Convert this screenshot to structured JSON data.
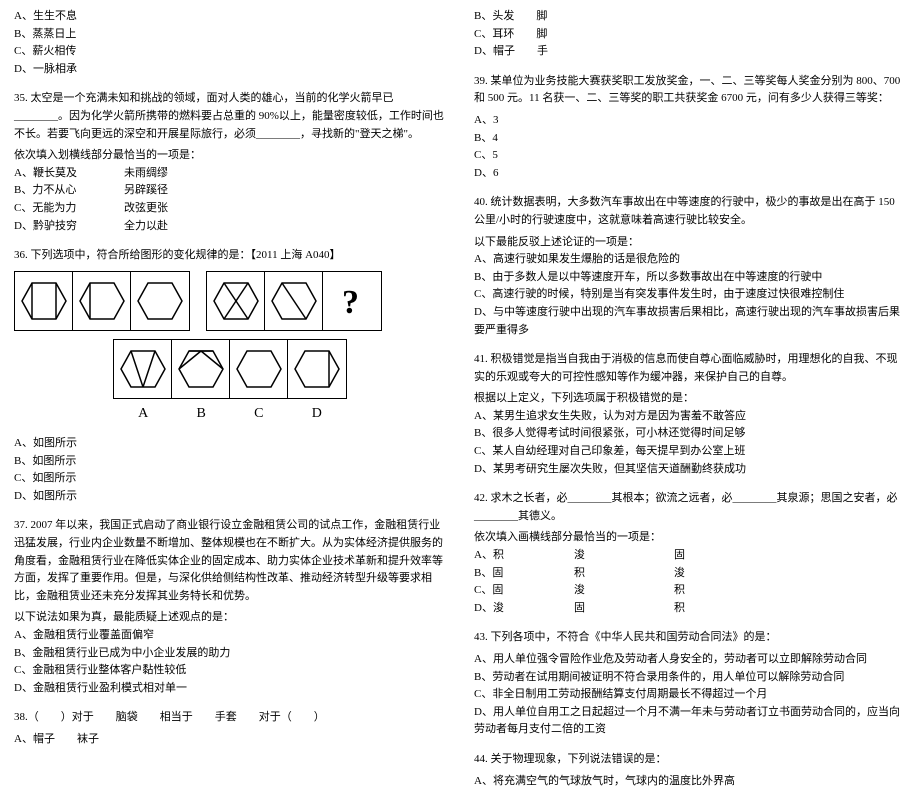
{
  "left": {
    "q_pre_options": {
      "A": "A、生生不息",
      "B": "B、蒸蒸日上",
      "C": "C、薪火相传",
      "D": "D、一脉相承"
    },
    "q35": {
      "body": "35. 太空是一个充满未知和挑战的领域，面对人类的雄心，当前的化学火箭早已________。因为化学火箭所携带的燃料要占总重的 90%以上，能量密度较低，工作时间也不长。若要飞向更远的深空和开展星际旅行，必须________，寻找新的\"登天之梯\"。",
      "instr": "依次填入划横线部分最恰当的一项是：",
      "A": {
        "a": "A、鞭长莫及",
        "b": "未雨绸缪"
      },
      "B": {
        "a": "B、力不从心",
        "b": "另辟蹊径"
      },
      "C": {
        "a": "C、无能为力",
        "b": "改弦更张"
      },
      "D": {
        "a": "D、黔驴技穷",
        "b": "全力以赴"
      }
    },
    "q36": {
      "body": "36. 下列选项中，符合所给图形的变化规律的是：【2011 上海 A040】",
      "letters": {
        "A": "A",
        "B": "B",
        "C": "C",
        "D": "D"
      },
      "opts": {
        "A": "A、如图所示",
        "B": "B、如图所示",
        "C": "C、如图所示",
        "D": "D、如图所示"
      }
    },
    "q37": {
      "body": "37. 2007 年以来，我国正式启动了商业银行设立金融租赁公司的试点工作，金融租赁行业迅猛发展，行业内企业数量不断增加、整体规模也在不断扩大。从为实体经济提供服务的角度看，金融租赁行业在降低实体企业的固定成本、助力实体企业技术革新和提升效率等方面，发挥了重要作用。但是，与深化供给侧结构性改革、推动经济转型升级等要求相比，金融租赁业还未充分发挥其业务特长和优势。",
      "instr": "以下说法如果为真，最能质疑上述观点的是：",
      "A": "A、金融租赁行业覆盖面偏窄",
      "B": "B、金融租赁行业已成为中小企业发展的助力",
      "C": "C、金融租赁行业整体客户黏性较低",
      "D": "D、金融租赁行业盈利模式相对单一"
    },
    "q38": {
      "body": "38.（　　）对于　　脑袋　　相当于　　手套　　对于（　　）",
      "A": "A、帽子　　袜子"
    }
  },
  "right": {
    "q38_cont": {
      "B": "B、头发　　脚",
      "C": "C、耳环　　脚",
      "D": "D、帽子　　手"
    },
    "q39": {
      "body": "39. 某单位为业务技能大赛获奖职工发放奖金，一、二、三等奖每人奖金分别为 800、700 和 500 元。11 名获一、二、三等奖的职工共获奖金 6700 元，问有多少人获得三等奖：",
      "A": "A、3",
      "B": "B、4",
      "C": "C、5",
      "D": "D、6"
    },
    "q40": {
      "body": "40. 统计数据表明，大多数汽车事故出在中等速度的行驶中，极少的事故是出在高于 150 公里/小时的行驶速度中，这就意味着高速行驶比较安全。",
      "instr": "以下最能反驳上述论证的一项是：",
      "A": "A、高速行驶如果发生爆胎的话是很危险的",
      "B": "B、由于多数人是以中等速度开车，所以多数事故出在中等速度的行驶中",
      "C": "C、高速行驶的时候，特别是当有突发事件发生时，由于速度过快很难控制住",
      "D": "D、与中等速度行驶中出现的汽车事故损害后果相比，高速行驶出现的汽车事故损害后果要严重得多"
    },
    "q41": {
      "body": "41. 积极错觉是指当自我由于消极的信息而使自尊心面临威胁时，用理想化的自我、不现实的乐观或夸大的可控性感知等作为缓冲器，来保护自己的自尊。",
      "instr": "根据以上定义，下列选项属于积极错觉的是：",
      "A": "A、某男生追求女生失败，认为对方是因为害羞不敢答应",
      "B": "B、很多人觉得考试时间很紧张，可小林还觉得时间足够",
      "C": "C、某人自幼经理对自己印象差，每天提早到办公室上班",
      "D": "D、某男考研究生屡次失败，但其坚信天道酬勤终获成功"
    },
    "q42": {
      "body": "42. 求木之长者，必________其根本；欲流之远者，必________其泉源；思国之安者，必________其德义。",
      "instr": "依次填入画横线部分最恰当的一项是：",
      "A": {
        "a": "A、积",
        "b": "浚",
        "c": "固"
      },
      "B": {
        "a": "B、固",
        "b": "积",
        "c": "浚"
      },
      "C": {
        "a": "C、固",
        "b": "浚",
        "c": "积"
      },
      "D": {
        "a": "D、浚",
        "b": "固",
        "c": "积"
      }
    },
    "q43": {
      "body": "43. 下列各项中，不符合《中华人民共和国劳动合同法》的是：",
      "A": "A、用人单位强令冒险作业危及劳动者人身安全的，劳动者可以立即解除劳动合同",
      "B": "B、劳动者在试用期间被证明不符合录用条件的，用人单位可以解除劳动合同",
      "C": "C、非全日制用工劳动报酬结算支付周期最长不得超过一个月",
      "D": "D、用人单位自用工之日起超过一个月不满一年未与劳动者订立书面劳动合同的，应当向劳动者每月支付二倍的工资"
    },
    "q44": {
      "body": "44. 关于物理现象，下列说法错误的是：",
      "A": "A、将充满空气的气球放气时，气球内的温度比外界高"
    }
  }
}
